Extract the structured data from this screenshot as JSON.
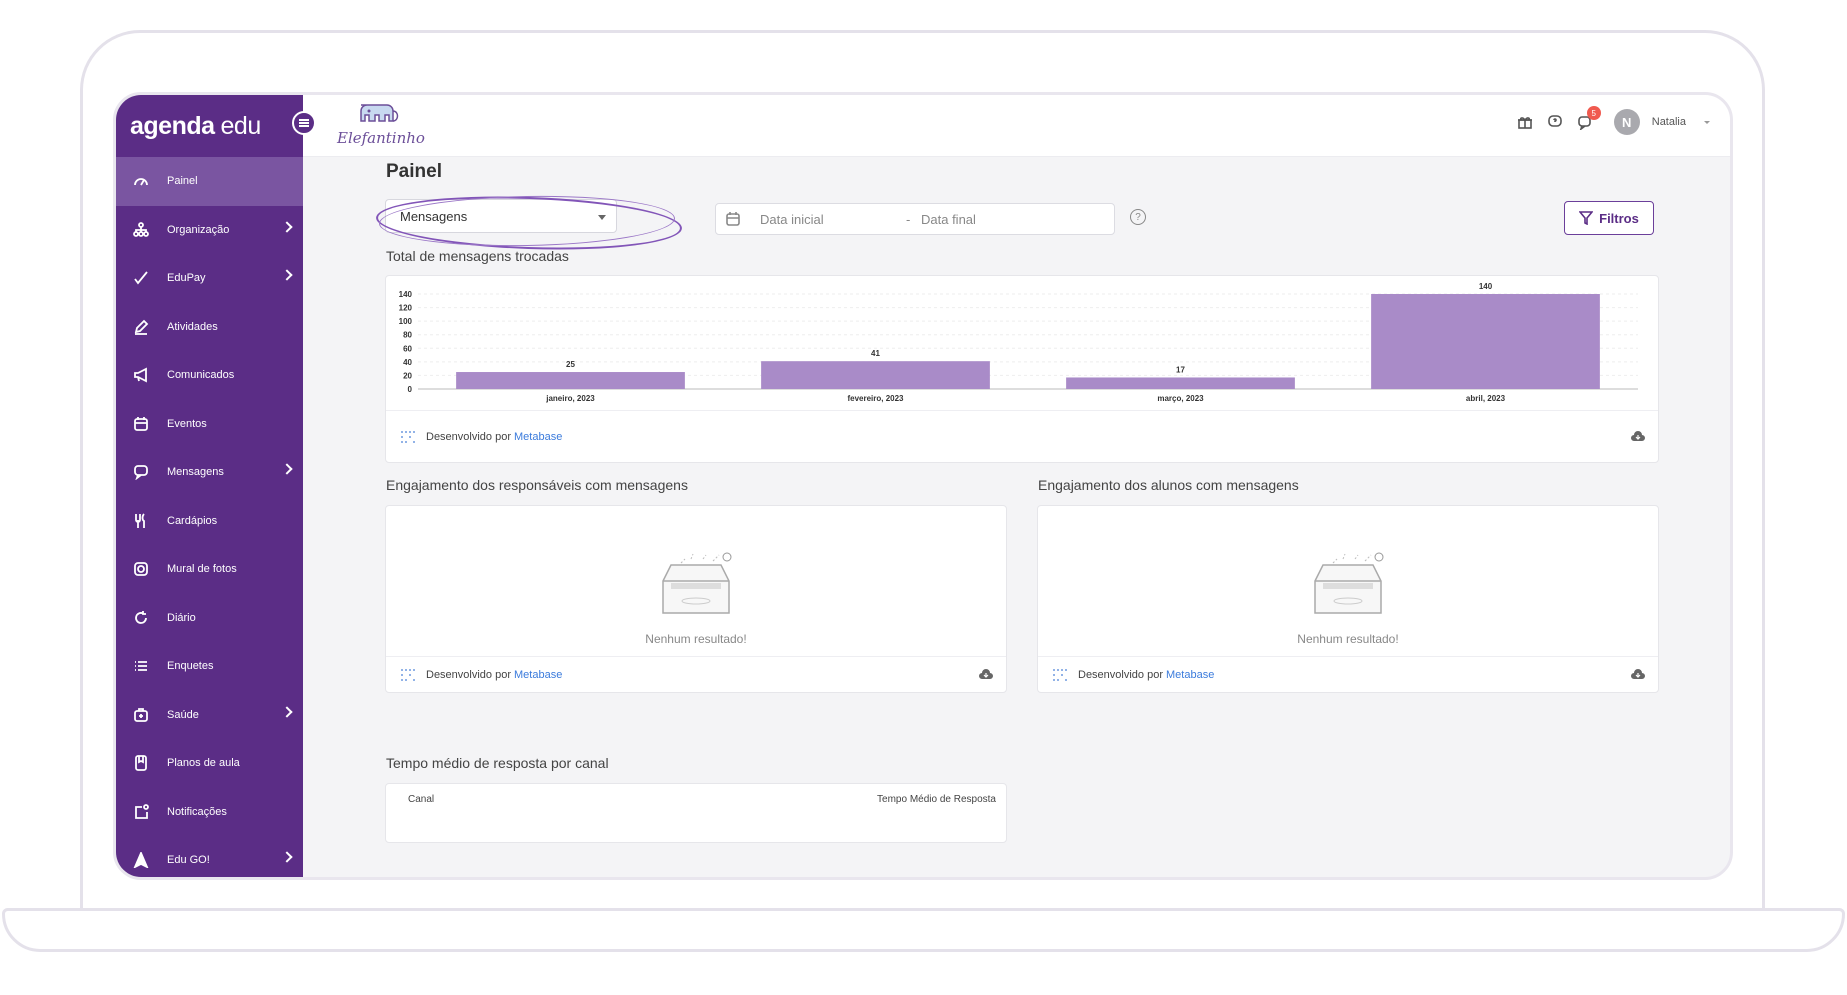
{
  "brand": {
    "part1": "agenda",
    "part2": "edu"
  },
  "school_logo": {
    "text": "Elefantinho"
  },
  "sidebar": {
    "items": [
      {
        "label": "Painel",
        "icon": "gauge-icon"
      },
      {
        "label": "Organização",
        "icon": "org-chart-icon"
      },
      {
        "label": "EduPay",
        "icon": "check-pen-icon"
      },
      {
        "label": "Atividades",
        "icon": "pencil-icon"
      },
      {
        "label": "Comunicados",
        "icon": "megaphone-icon"
      },
      {
        "label": "Eventos",
        "icon": "calendar-icon"
      },
      {
        "label": "Mensagens",
        "icon": "chat-icon"
      },
      {
        "label": "Cardápios",
        "icon": "cutlery-icon"
      },
      {
        "label": "Mural de fotos",
        "icon": "camera-icon"
      },
      {
        "label": "Diário",
        "icon": "refresh-icon"
      },
      {
        "label": "Enquetes",
        "icon": "list-icon"
      },
      {
        "label": "Saúde",
        "icon": "medical-bag-icon"
      },
      {
        "label": "Planos de aula",
        "icon": "notebook-icon"
      },
      {
        "label": "Notificações",
        "icon": "notification-icon"
      },
      {
        "label": "Edu GO!",
        "icon": "navigation-arrow-icon"
      }
    ]
  },
  "topbar": {
    "notification_count": "5",
    "avatar_initial": "N",
    "user_name": "Natalia"
  },
  "page": {
    "title": "Painel"
  },
  "filters": {
    "select_value": "Mensagens",
    "date_start_placeholder": "Data inicial",
    "date_separator": "-",
    "date_end_placeholder": "Data final",
    "help_symbol": "?",
    "filters_button": "Filtros"
  },
  "charts": {
    "total_title": "Total de mensagens trocadas",
    "responsaveis_title": "Engajamento dos responsáveis com mensagens",
    "alunos_title": "Engajamento dos alunos com mensagens",
    "tempo_title": "Tempo médio de resposta por canal",
    "footer_text": "Desenvolvido por",
    "footer_link": "Metabase",
    "empty_text": "Nenhum resultado!",
    "table_col1": "Canal",
    "table_col2": "Tempo Médio de Resposta"
  },
  "chart_data": {
    "type": "bar",
    "title": "Total de mensagens trocadas",
    "categories": [
      "janeiro, 2023",
      "fevereiro, 2023",
      "março, 2023",
      "abril, 2023"
    ],
    "values": [
      25,
      41,
      17,
      140
    ],
    "yticks": [
      0,
      20,
      40,
      60,
      80,
      100,
      120,
      140
    ],
    "ylim": [
      0,
      140
    ],
    "bar_color": "#a98bc8",
    "grid": true
  },
  "colors": {
    "sidebar": "#5b2d86",
    "accent": "#6b3f9a",
    "link": "#3b7bdc"
  }
}
